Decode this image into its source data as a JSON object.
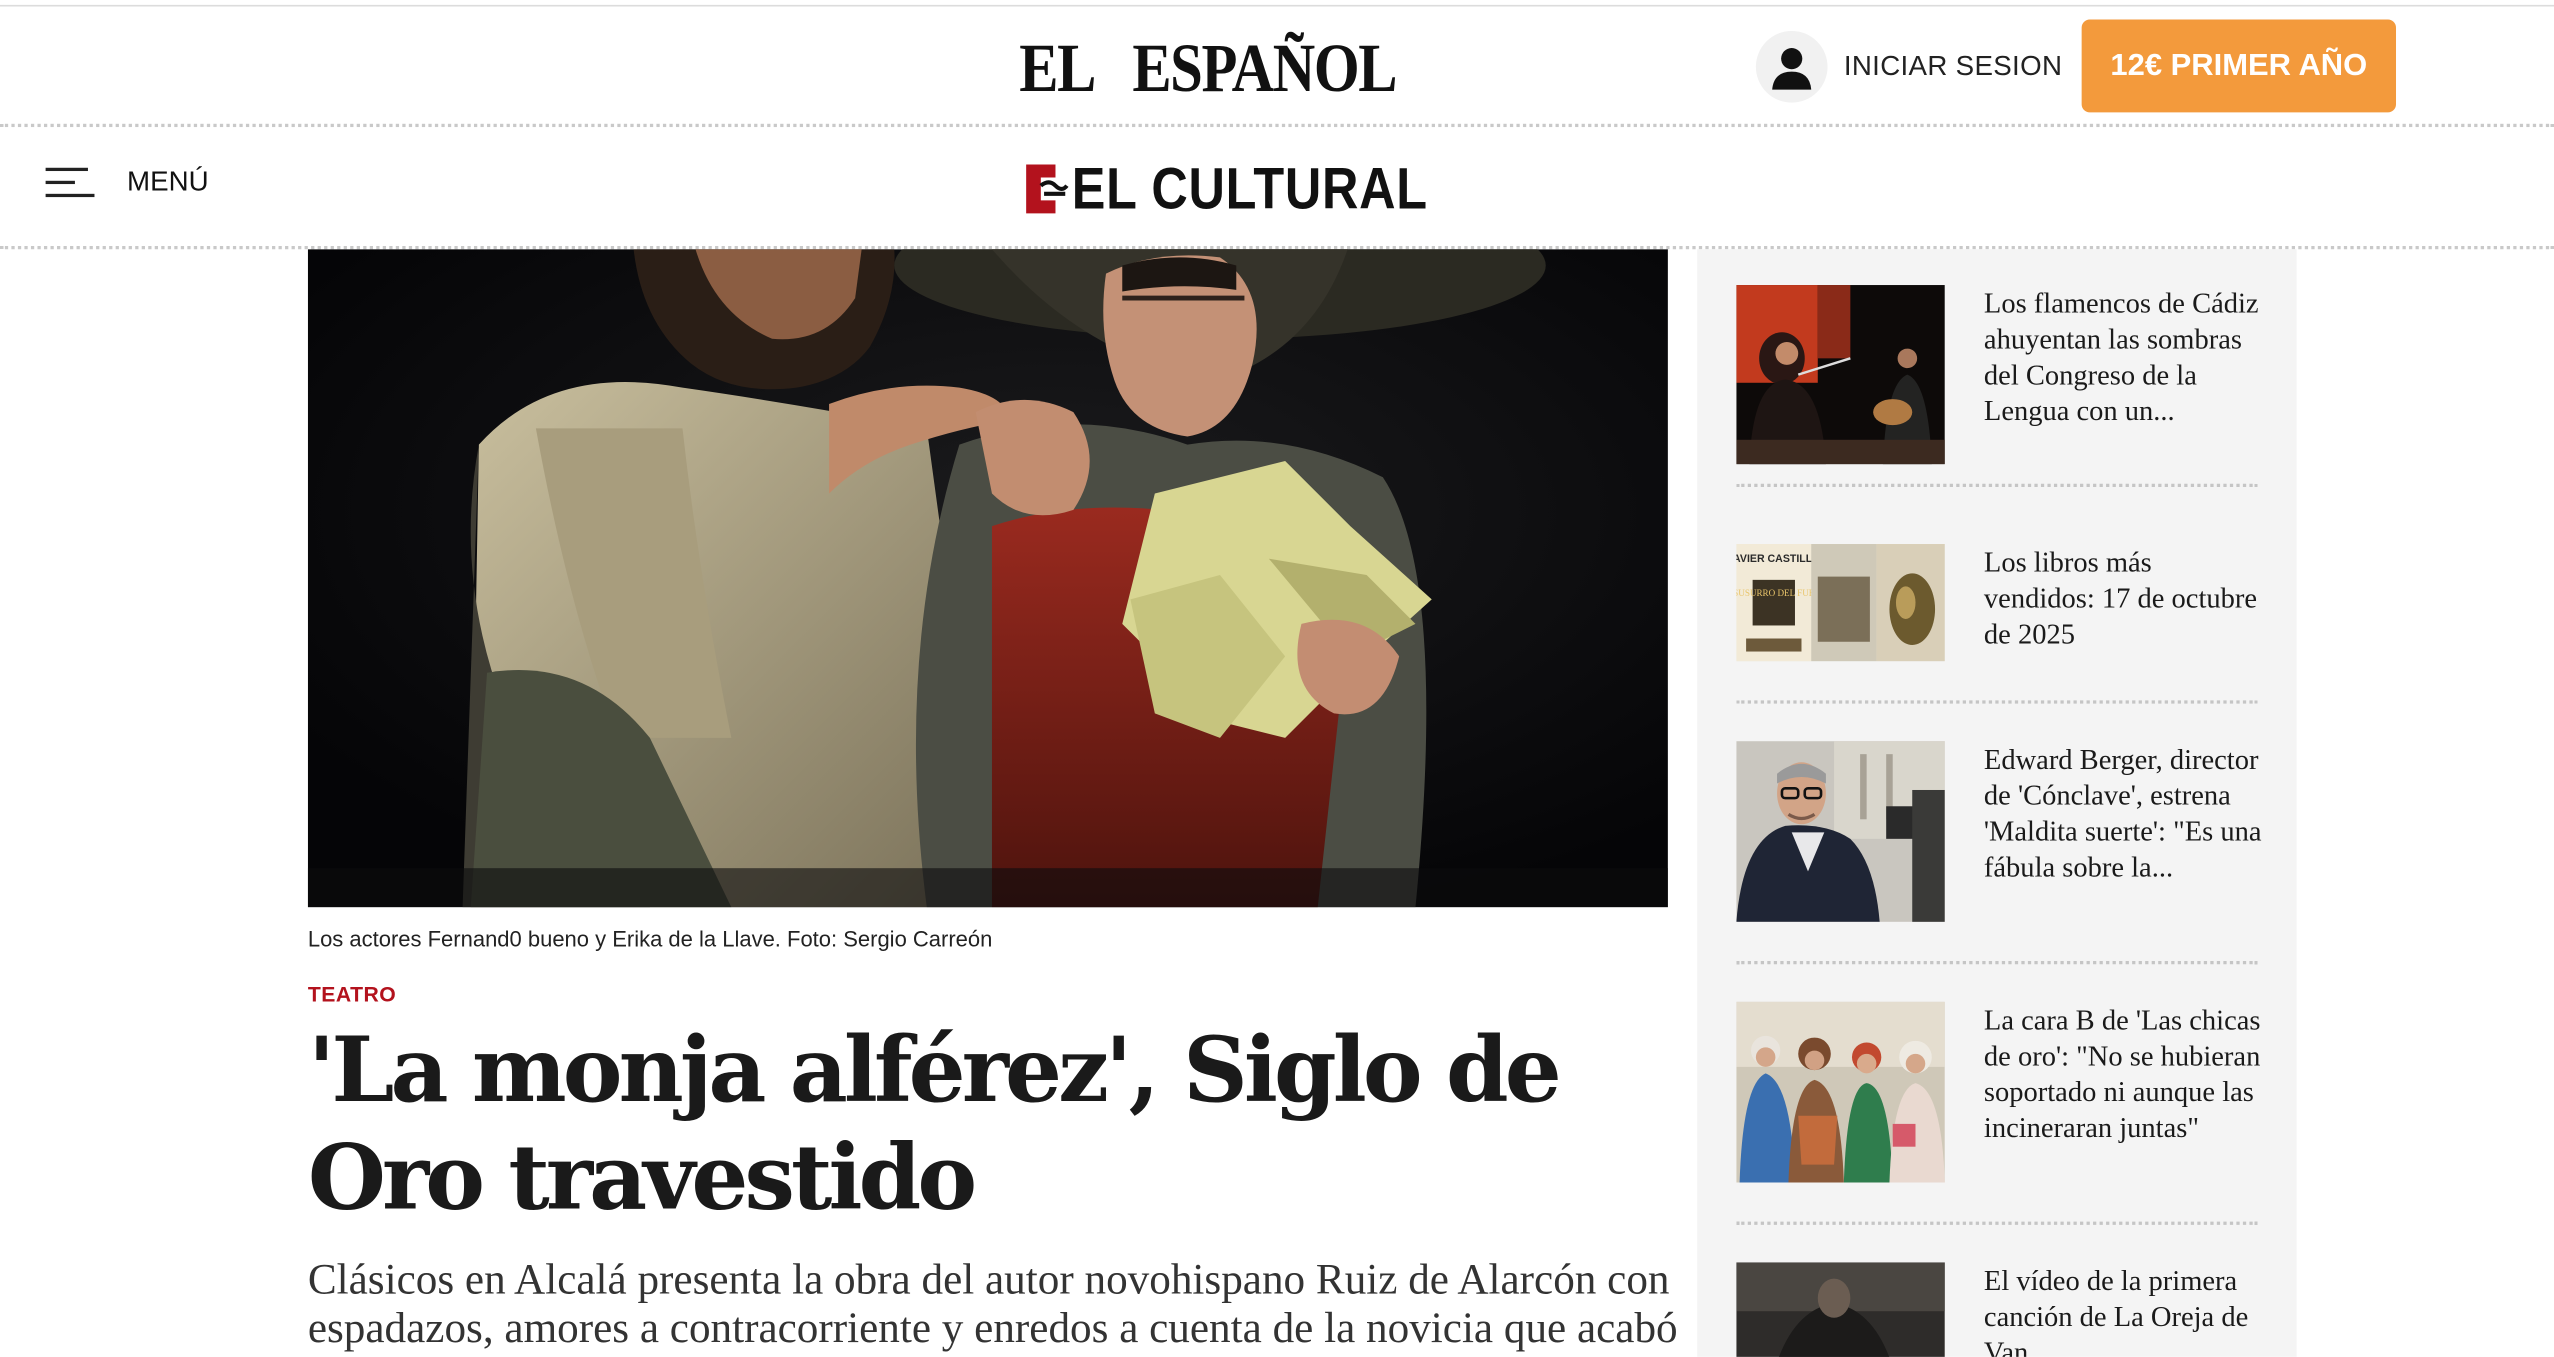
{
  "site": {
    "logo_left": "EL",
    "logo_right": "ESPAÑOL",
    "login_label": "INICIAR SESION",
    "subscribe_label": "12€ PRIMER AÑO",
    "menu_label": "MENÚ",
    "section_logo": "EL CULTURAL"
  },
  "article": {
    "caption": "Los actores Fernand0 bueno y Erika de la Llave. Foto: Sergio Carreón",
    "section": "TEATRO",
    "headline": "'La monja alférez', Siglo de Oro travestido",
    "standfirst": "Clásicos en Alcalá presenta la obra del autor novohispano Ruiz de Alarcón con espadazos, amores a contracorriente y enredos a cuenta de la novicia que acabó"
  },
  "sidebar": {
    "items": [
      {
        "title": "Los flamencos de Cádiz ahuyentan las sombras del Congreso de la Lengua con un..."
      },
      {
        "title": "Los libros más vendidos: 17 de octubre de 2025"
      },
      {
        "title": "Edward Berger, director de 'Cónclave', estrena 'Maldita suerte': \"Es una fábula sobre la..."
      },
      {
        "title": "La cara B de 'Las chicas de oro': \"No se hubieran soportado ni aunque las incineraran juntas\""
      },
      {
        "title": "El vídeo de la primera canción de La Oreja de Van"
      }
    ],
    "book_covers": {
      "author": "JAVIER CASTILLO",
      "book_title": "EL SUSURRO DEL FUEGO"
    }
  }
}
